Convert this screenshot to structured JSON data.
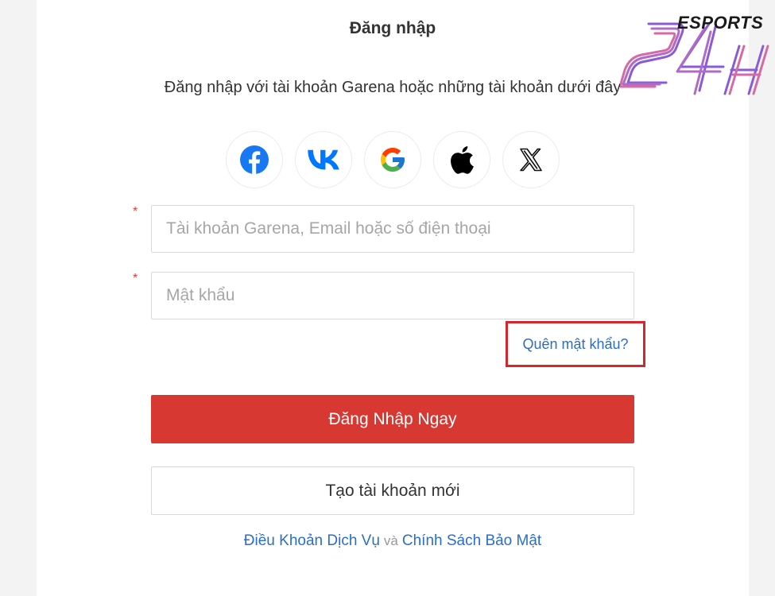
{
  "title": "Đăng nhập",
  "subtitle": "Đăng nhập với tài khoản Garena hoặc những tài khoản dưới đây",
  "social": [
    {
      "name": "facebook",
      "icon": "facebook-icon",
      "color": "#1877f2"
    },
    {
      "name": "vk",
      "icon": "vk-icon",
      "color": "#0077ff"
    },
    {
      "name": "google",
      "icon": "google-icon"
    },
    {
      "name": "apple",
      "icon": "apple-icon",
      "color": "#000000"
    },
    {
      "name": "x",
      "icon": "x-icon",
      "color": "#000000"
    }
  ],
  "form": {
    "account": {
      "placeholder": "Tài khoản Garena, Email hoặc số điện thoại",
      "value": "",
      "required_mark": "*"
    },
    "password": {
      "placeholder": "Mật khẩu",
      "value": "",
      "required_mark": "*"
    },
    "forgot_label": "Quên mật khẩu?",
    "login_label": "Đăng Nhập Ngay",
    "register_label": "Tạo tài khoản mới"
  },
  "terms": {
    "tos": "Điều Khoản Dịch Vụ",
    "and": "và",
    "privacy": "Chính Sách Bảo Mật"
  },
  "watermark": {
    "text": "ESPORTS",
    "mark": "24H"
  },
  "colors": {
    "accent": "#d73832",
    "link": "#2a6ec9",
    "highlight_border": "#d6262b",
    "logo_purple": "#8a5bd6",
    "logo_pink": "#d46aa6"
  }
}
